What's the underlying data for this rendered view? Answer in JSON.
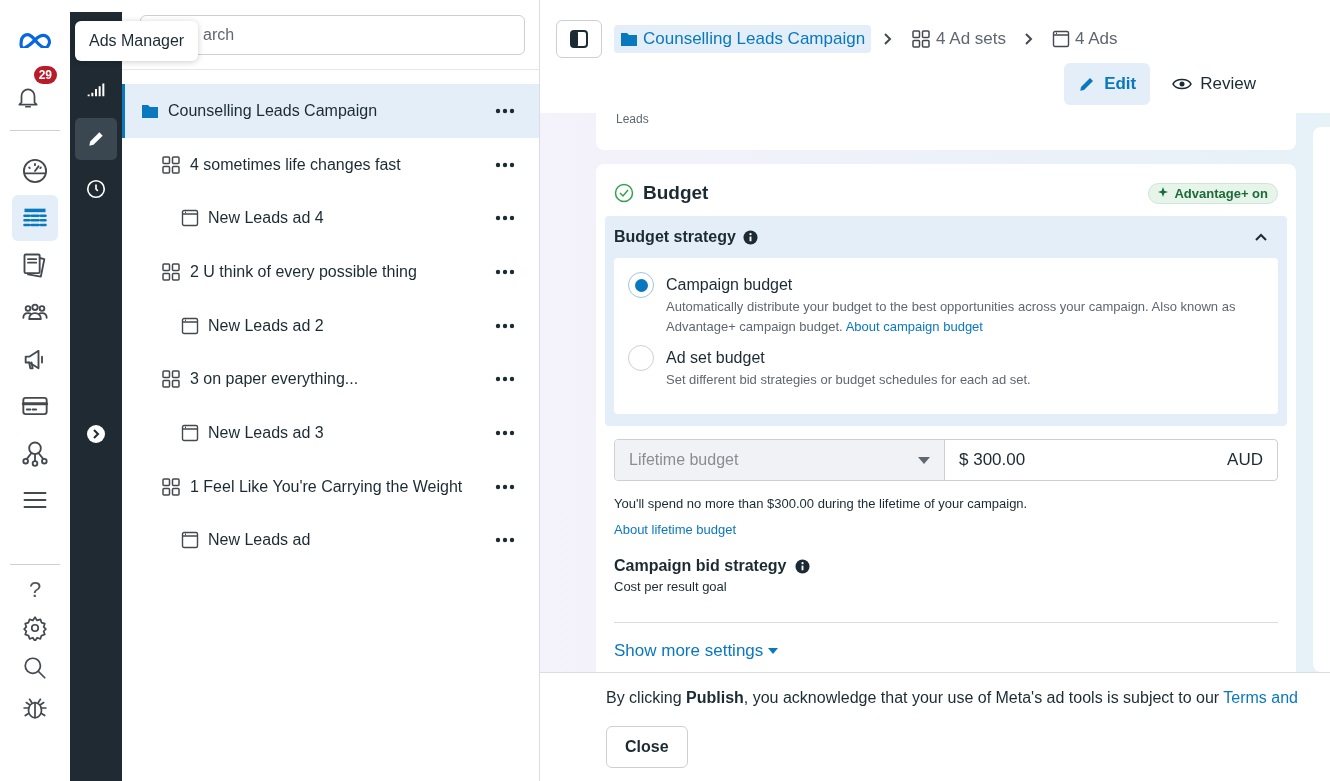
{
  "tooltip": "Ads Manager",
  "notifications": {
    "count": "29"
  },
  "rail": [
    {
      "selected": false
    },
    {
      "selected": true
    },
    {
      "selected": false
    },
    {
      "selected": false
    },
    {
      "selected": false
    },
    {
      "selected": false
    },
    {
      "selected": false
    },
    {
      "selected": false
    }
  ],
  "help": "?",
  "tool_strip": [
    {
      "selected": false
    },
    {
      "selected": true
    },
    {
      "selected": false
    }
  ],
  "search": {
    "placeholder": "arch"
  },
  "tree": [
    {
      "label": "Counselling Leads Campaign",
      "kind": "campaign",
      "selected": true,
      "children": [
        {
          "label": "4 sometimes life changes fast",
          "kind": "adset",
          "selected": false,
          "children": [
            {
              "label": "New Leads ad 4",
              "kind": "ad",
              "selected": false
            }
          ]
        },
        {
          "label": "2 U think of every possible thing",
          "kind": "adset",
          "selected": false,
          "children": [
            {
              "label": "New Leads ad 2",
              "kind": "ad",
              "selected": false
            }
          ]
        },
        {
          "label": "3 on paper everything...",
          "kind": "adset",
          "selected": false,
          "children": [
            {
              "label": "New Leads ad 3",
              "kind": "ad",
              "selected": false
            }
          ]
        },
        {
          "label": "1 Feel Like You're Carrying the Weight",
          "kind": "adset",
          "selected": false,
          "children": [
            {
              "label": "New Leads ad",
              "kind": "ad",
              "selected": false
            }
          ]
        }
      ]
    }
  ],
  "breadcrumb": [
    {
      "label": "Counselling Leads Campaign",
      "kind": "campaign",
      "selected": true
    },
    {
      "label": "4 Ad sets",
      "kind": "adset",
      "selected": false
    },
    {
      "label": "4 Ads",
      "kind": "ad",
      "selected": false
    }
  ],
  "modes": [
    {
      "label": "Edit",
      "selected": true
    },
    {
      "label": "Review",
      "selected": false
    }
  ],
  "previous_card": {
    "text": "Leads"
  },
  "budget": {
    "title": "Budget",
    "badge": "Advantage+ on",
    "strategy": {
      "title": "Budget strategy",
      "expanded": true,
      "options": [
        {
          "label": "Campaign budget",
          "description": "Automatically distribute your budget to the best opportunities across your campaign. Also known as Advantage+ campaign budget.",
          "link": "About campaign budget",
          "selected": true
        },
        {
          "label": "Ad set budget",
          "description": "Set different bid strategies or budget schedules for each ad set.",
          "selected": false
        }
      ]
    },
    "budget_type": "Lifetime budget",
    "amount": "$ 300.00",
    "currency": "AUD",
    "note": "You'll spend no more than $300.00 during the lifetime of your campaign.",
    "note_link": "About lifetime budget",
    "bid_strategy": {
      "title": "Campaign bid strategy",
      "value": "Cost per result goal"
    },
    "show_more": "Show more settings"
  },
  "footer": {
    "notice": "By clicking **Publish**, you acknowledge that your use of Meta's ad tools is subject to our ",
    "link": "Terms and",
    "close": "Close"
  }
}
